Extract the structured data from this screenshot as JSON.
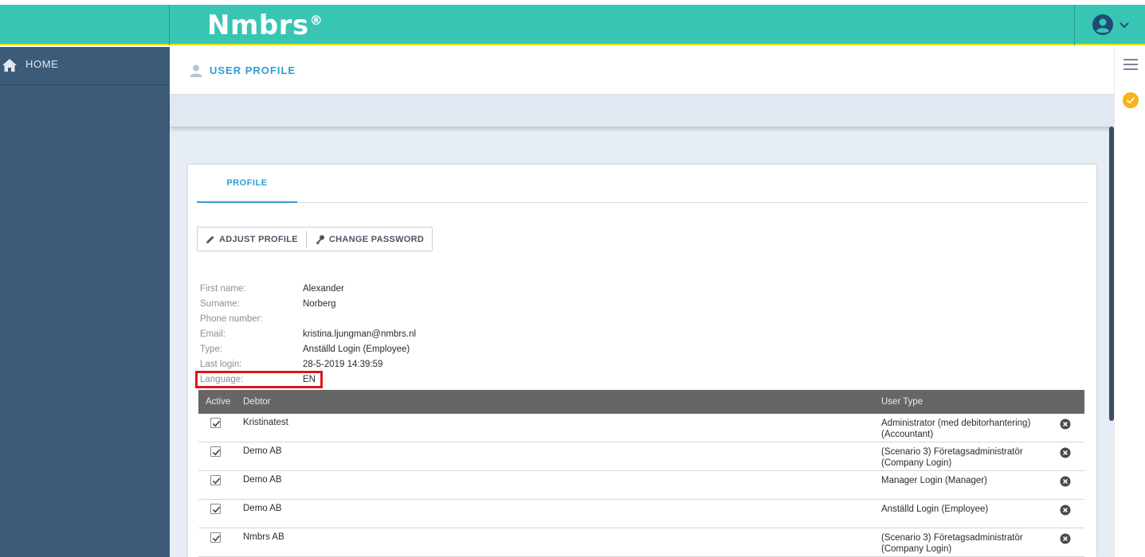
{
  "app": {
    "logo": "Nmbrs",
    "logo_mark": "®"
  },
  "sidebar": {
    "home_label": "HOME"
  },
  "page": {
    "title": "USER PROFILE"
  },
  "tabs": [
    {
      "label": "PROFILE",
      "active": true
    }
  ],
  "actions": {
    "adjust_profile": "ADJUST PROFILE",
    "change_password": "CHANGE PASSWORD"
  },
  "profile": {
    "fields": [
      {
        "label": "First name:",
        "value": "Alexander"
      },
      {
        "label": "Surname:",
        "value": "Norberg"
      },
      {
        "label": "Phone number:",
        "value": ""
      },
      {
        "label": "Email:",
        "value": "kristina.ljungman@nmbrs.nl"
      },
      {
        "label": "Type:",
        "value": "Anställd Login (Employee)"
      },
      {
        "label": "Last login:",
        "value": "28-5-2019 14:39:59"
      },
      {
        "label": "Language:",
        "value": "EN"
      }
    ]
  },
  "table": {
    "headers": {
      "active": "Active",
      "debtor": "Debtor",
      "user_type": "User Type"
    },
    "rows": [
      {
        "active": true,
        "debtor": "Kristinatest",
        "user_type_1": "Administrator (med debitorhantering)",
        "user_type_2": "(Accountant)"
      },
      {
        "active": true,
        "debtor": "Demo AB",
        "user_type_1": "(Scenario 3) Företagsadministratör",
        "user_type_2": "(Company Login)"
      },
      {
        "active": true,
        "debtor": "Demo AB",
        "user_type_1": "Manager Login (Manager)",
        "user_type_2": ""
      },
      {
        "active": true,
        "debtor": "Demo AB",
        "user_type_1": "Anställd Login (Employee)",
        "user_type_2": ""
      },
      {
        "active": true,
        "debtor": "Nmbrs AB",
        "user_type_1": "(Scenario 3) Företagsadministratör",
        "user_type_2": "(Company Login)"
      }
    ]
  },
  "colors": {
    "brand": "#38c5b3",
    "sidebar": "#3d5a78",
    "accent": "#2e9fd0",
    "highlight": "#e0141e",
    "status": "#f5b31d"
  },
  "icons": [
    "home-icon",
    "user-icon",
    "account-circle-icon",
    "chevron-down-icon",
    "pencil-icon",
    "key-icon",
    "hamburger-menu-icon",
    "check-badge-icon",
    "checkbox-checked-icon",
    "remove-circle-icon"
  ]
}
